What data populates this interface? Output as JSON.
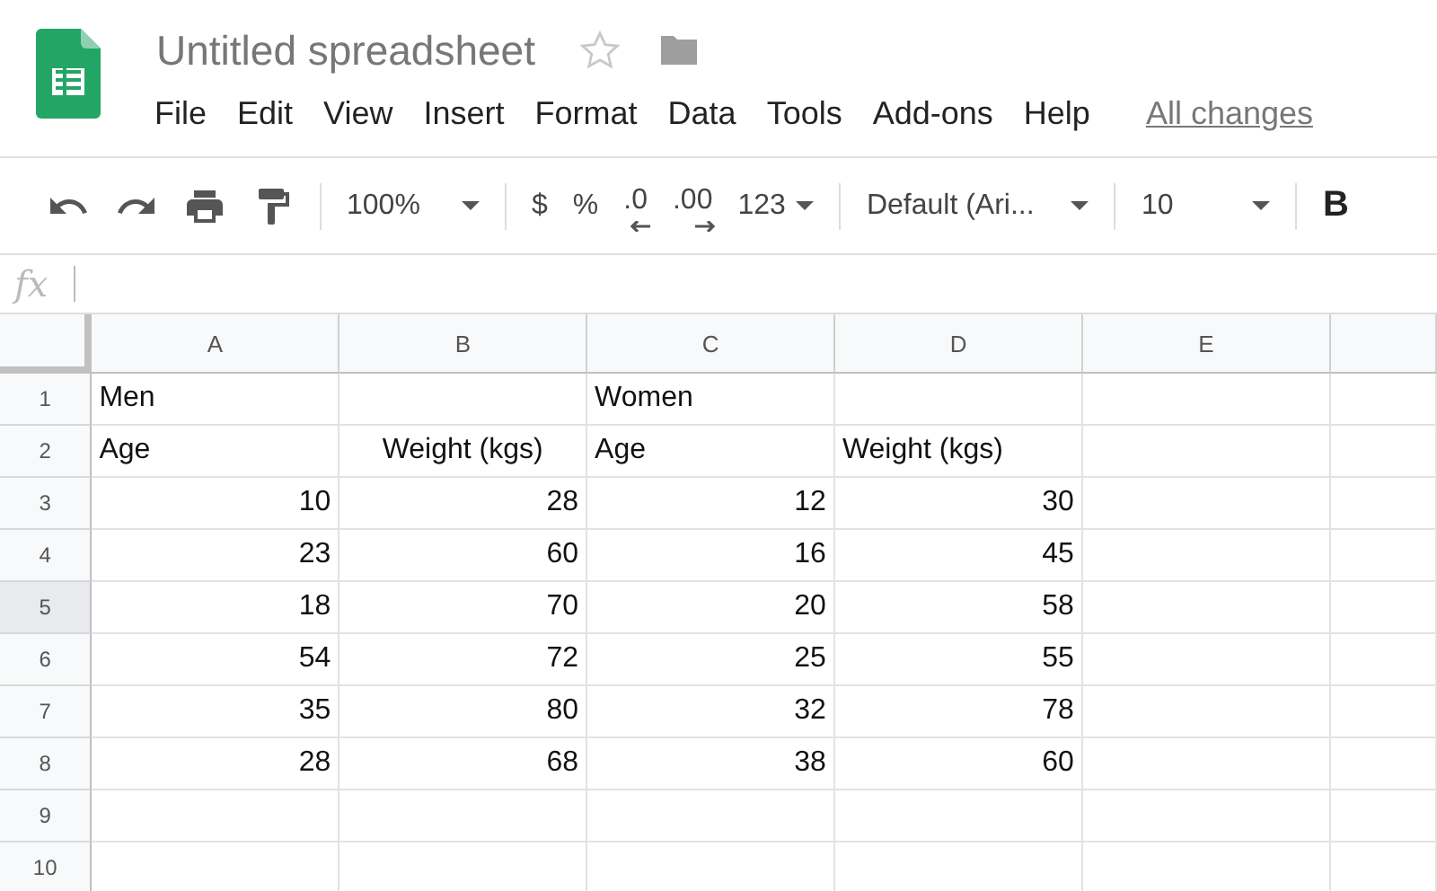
{
  "document": {
    "title": "Untitled spreadsheet",
    "starred": false
  },
  "menu": [
    "File",
    "Edit",
    "View",
    "Insert",
    "Format",
    "Data",
    "Tools",
    "Add-ons",
    "Help"
  ],
  "save_status": "All changes",
  "toolbar": {
    "zoom": "100%",
    "currency": "$",
    "percent": "%",
    "decrease_decimals": ".0",
    "increase_decimals": ".00",
    "number_format": "123",
    "font": "Default (Ari...",
    "font_size": "10",
    "bold": "B"
  },
  "formula_bar": {
    "label": "fx"
  },
  "columns": [
    "A",
    "B",
    "C",
    "D",
    "E"
  ],
  "rows": [
    {
      "label": "1",
      "highlighted": false,
      "cells": [
        {
          "kind": "text",
          "text": "Men"
        },
        {
          "kind": "empty"
        },
        {
          "kind": "text",
          "text": "Women"
        },
        {
          "kind": "empty"
        },
        {
          "kind": "empty"
        }
      ]
    },
    {
      "label": "2",
      "highlighted": false,
      "cells": [
        {
          "kind": "text",
          "text": "Age"
        },
        {
          "kind": "centered",
          "text": "Weight (kgs)"
        },
        {
          "kind": "text",
          "text": "Age"
        },
        {
          "kind": "text",
          "text": "Weight (kgs)"
        },
        {
          "kind": "empty"
        }
      ]
    },
    {
      "label": "3",
      "highlighted": false,
      "cells": [
        {
          "kind": "number",
          "text": "10"
        },
        {
          "kind": "number",
          "text": "28"
        },
        {
          "kind": "number",
          "text": "12"
        },
        {
          "kind": "number",
          "text": "30"
        },
        {
          "kind": "empty"
        }
      ]
    },
    {
      "label": "4",
      "highlighted": false,
      "cells": [
        {
          "kind": "number",
          "text": "23"
        },
        {
          "kind": "number",
          "text": "60"
        },
        {
          "kind": "number",
          "text": "16"
        },
        {
          "kind": "number",
          "text": "45"
        },
        {
          "kind": "empty"
        }
      ]
    },
    {
      "label": "5",
      "highlighted": true,
      "cells": [
        {
          "kind": "number",
          "text": "18"
        },
        {
          "kind": "number",
          "text": "70"
        },
        {
          "kind": "number",
          "text": "20"
        },
        {
          "kind": "number",
          "text": "58"
        },
        {
          "kind": "empty"
        }
      ]
    },
    {
      "label": "6",
      "highlighted": false,
      "cells": [
        {
          "kind": "number",
          "text": "54"
        },
        {
          "kind": "number",
          "text": "72"
        },
        {
          "kind": "number",
          "text": "25"
        },
        {
          "kind": "number",
          "text": "55"
        },
        {
          "kind": "empty"
        }
      ]
    },
    {
      "label": "7",
      "highlighted": false,
      "cells": [
        {
          "kind": "number",
          "text": "35"
        },
        {
          "kind": "number",
          "text": "80"
        },
        {
          "kind": "number",
          "text": "32"
        },
        {
          "kind": "number",
          "text": "78"
        },
        {
          "kind": "empty"
        }
      ]
    },
    {
      "label": "8",
      "highlighted": false,
      "cells": [
        {
          "kind": "number",
          "text": "28"
        },
        {
          "kind": "number",
          "text": "68"
        },
        {
          "kind": "number",
          "text": "38"
        },
        {
          "kind": "number",
          "text": "60"
        },
        {
          "kind": "empty"
        }
      ]
    },
    {
      "label": "9",
      "highlighted": false,
      "cells": [
        {
          "kind": "empty"
        },
        {
          "kind": "empty"
        },
        {
          "kind": "empty"
        },
        {
          "kind": "empty"
        },
        {
          "kind": "empty"
        }
      ]
    },
    {
      "label": "10",
      "highlighted": false,
      "cells": [
        {
          "kind": "empty"
        },
        {
          "kind": "empty"
        },
        {
          "kind": "empty"
        },
        {
          "kind": "empty"
        },
        {
          "kind": "empty"
        }
      ]
    }
  ]
}
